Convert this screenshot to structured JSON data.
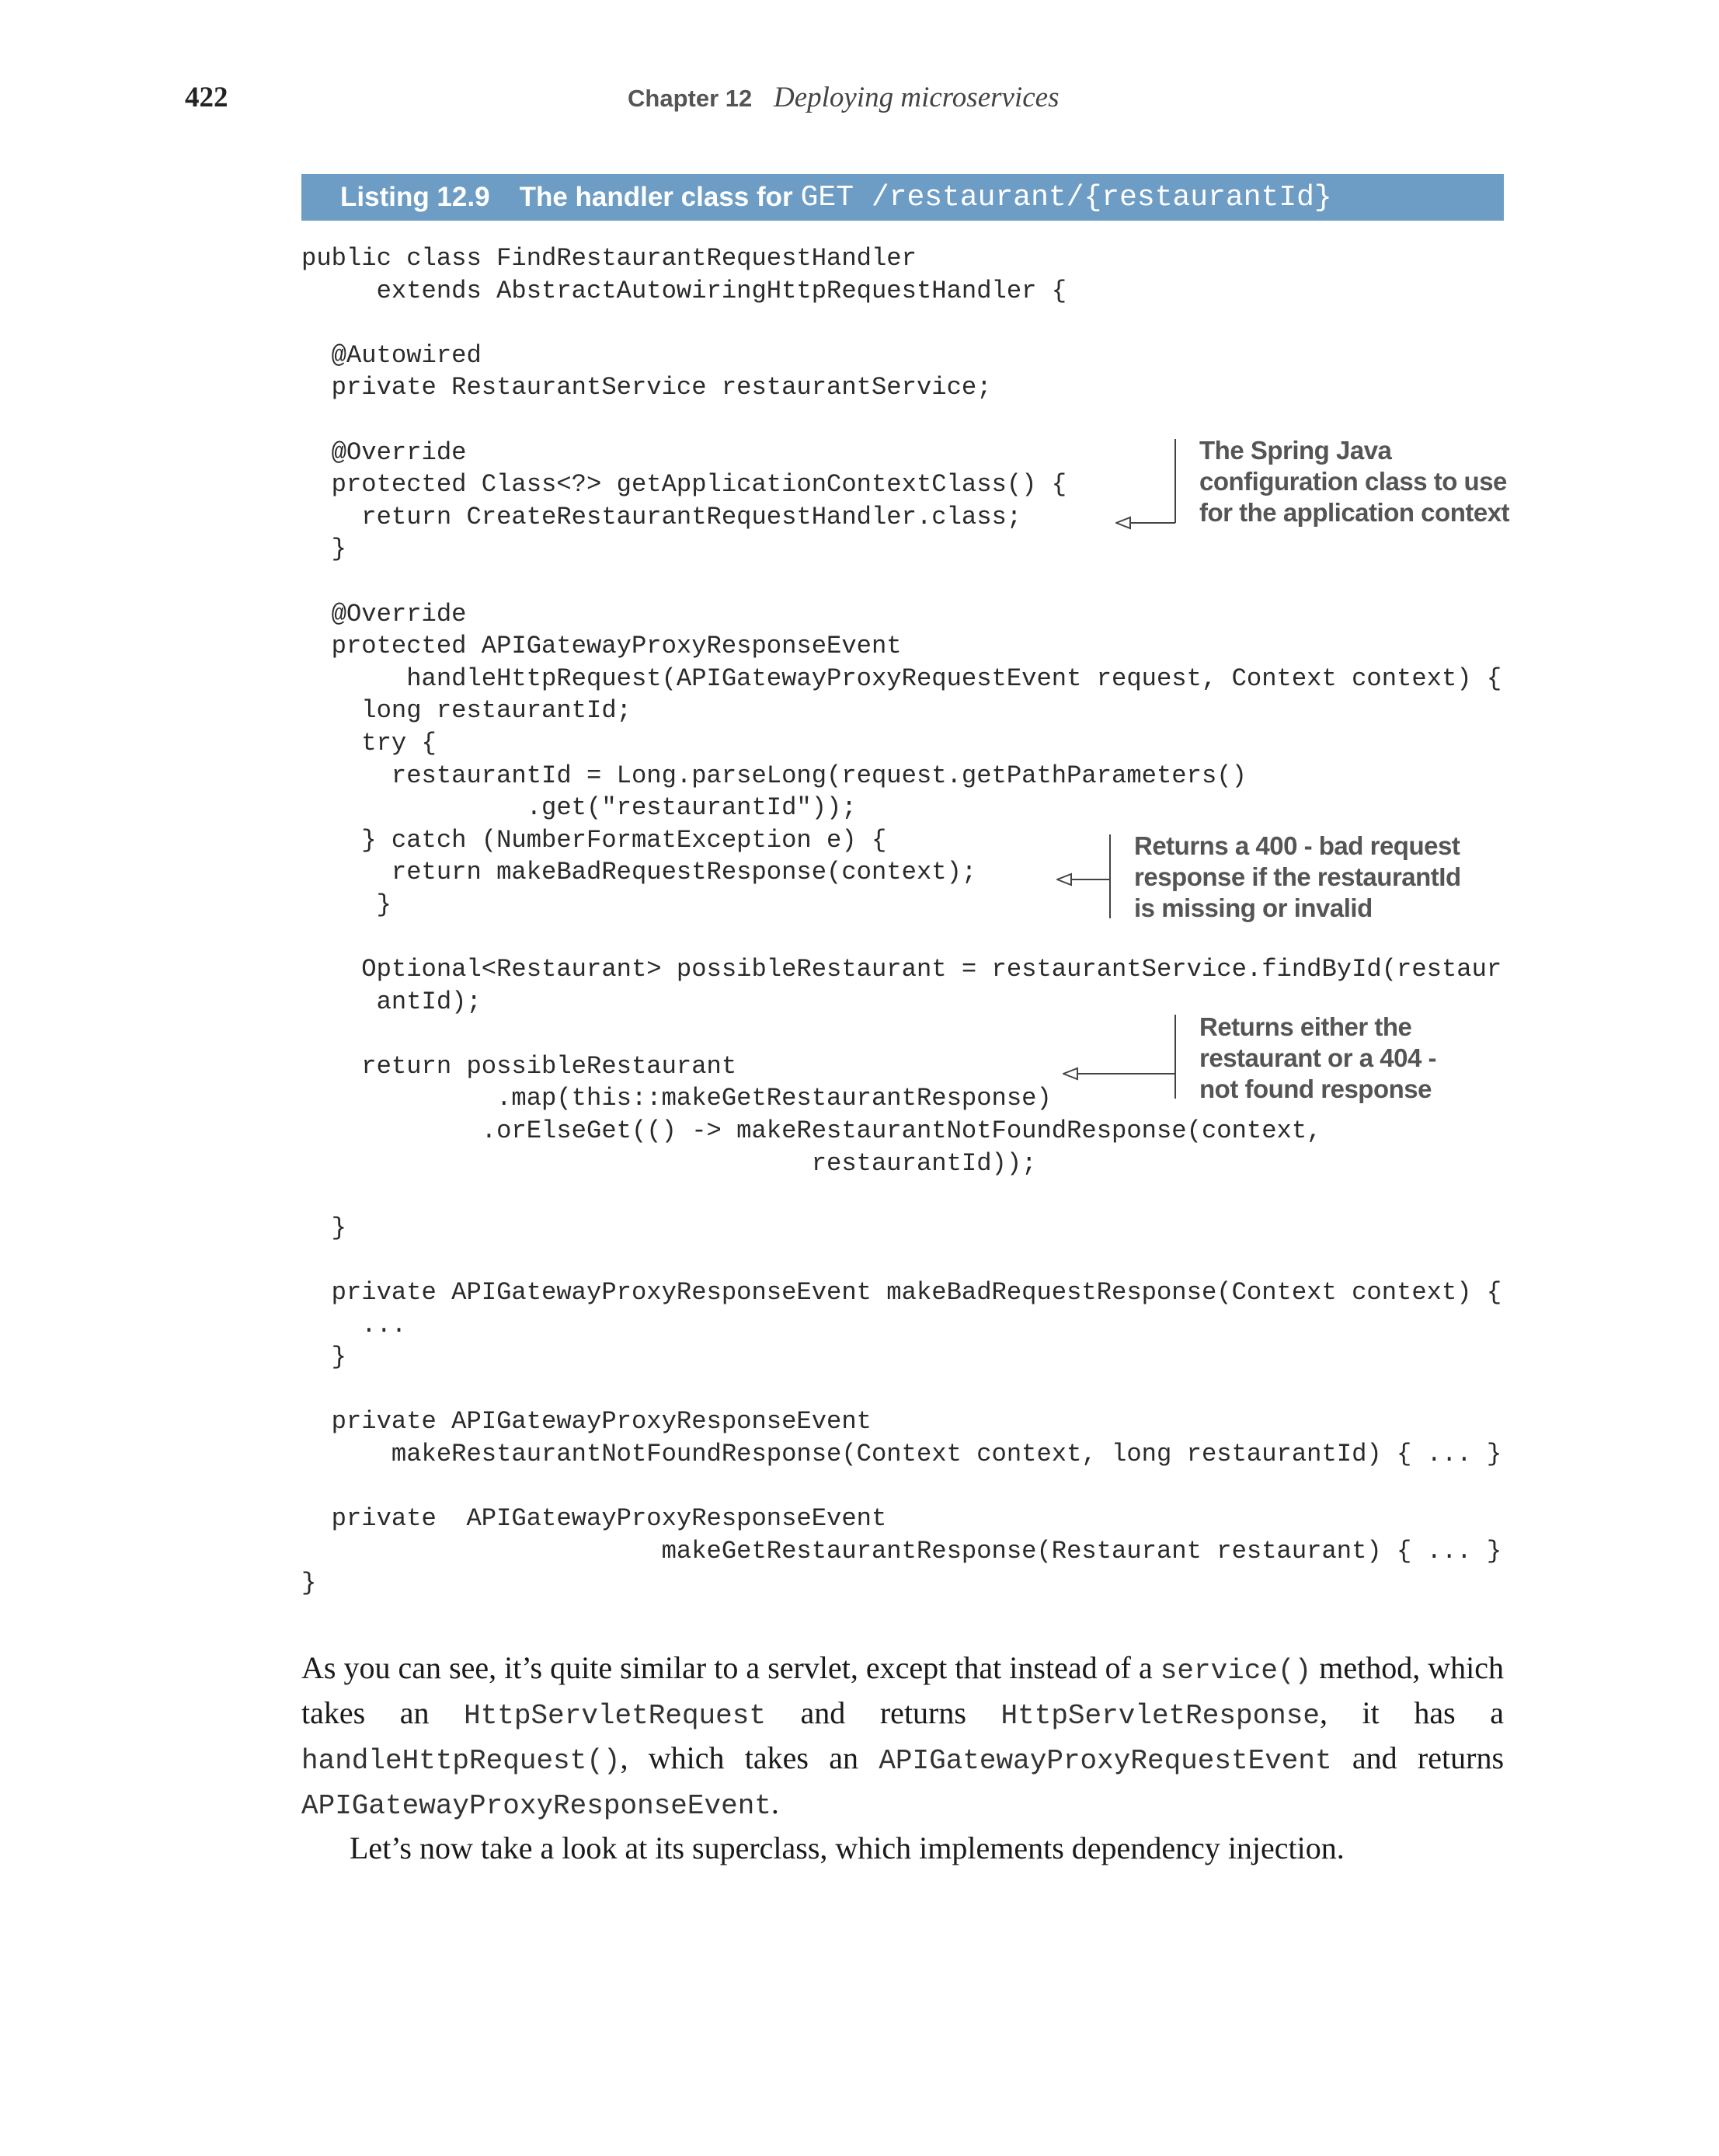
{
  "header": {
    "page_number": "422",
    "chapter_label": "Chapter 12",
    "chapter_title": "Deploying microservices"
  },
  "listing": {
    "label": "Listing 12.9",
    "caption": "The handler class for",
    "caption_code": "GET /restaurant/{restaurantId}"
  },
  "code_lines": [
    "public class FindRestaurantRequestHandler",
    "     extends AbstractAutowiringHttpRequestHandler {",
    "",
    "  @Autowired",
    "  private RestaurantService restaurantService;",
    "",
    "  @Override",
    "  protected Class<?> getApplicationContextClass() {",
    "    return CreateRestaurantRequestHandler.class;",
    "  }",
    "",
    "  @Override",
    "  protected APIGatewayProxyResponseEvent",
    "       handleHttpRequest(APIGatewayProxyRequestEvent request, Context context) {",
    "    long restaurantId;",
    "    try {",
    "      restaurantId = Long.parseLong(request.getPathParameters()",
    "               .get(\"restaurantId\"));",
    "    } catch (NumberFormatException e) {",
    "      return makeBadRequestResponse(context);",
    "     }",
    "",
    "    Optional<Restaurant> possibleRestaurant = restaurantService.findById(restaur",
    "     antId);",
    "",
    "    return possibleRestaurant",
    "             .map(this::makeGetRestaurantResponse)",
    "            .orElseGet(() -> makeRestaurantNotFoundResponse(context,",
    "                                  restaurantId));",
    "",
    "  }",
    "",
    "  private APIGatewayProxyResponseEvent makeBadRequestResponse(Context context) {",
    "    ...",
    "  }",
    "",
    "  private APIGatewayProxyResponseEvent",
    "      makeRestaurantNotFoundResponse(Context context, long restaurantId) { ... }",
    "",
    "  private  APIGatewayProxyResponseEvent",
    "                        makeGetRestaurantResponse(Restaurant restaurant) { ... }",
    "}"
  ],
  "annotations": {
    "context_class": "The Spring Java\nconfiguration class to use\nfor the application context",
    "bad_request": "Returns a 400 - bad request\nresponse if the restaurantId\nis missing or invalid",
    "not_found": "Returns either the\nrestaurant or a 404 -\nnot found response"
  },
  "body": {
    "p1_a": "As you can see, it’s quite similar to a servlet, except that instead of a ",
    "p1_code1": "service()",
    "p1_b": " method, which takes an ",
    "p1_code2": "HttpServletRequest",
    "p1_c": " and returns ",
    "p1_code3": "HttpServletResponse",
    "p1_d": ", it has a ",
    "p1_code4": "handleHttpRequest()",
    "p1_e": ", which takes an ",
    "p1_code5": "APIGatewayProxyRequestEvent",
    "p1_f": " and returns ",
    "p1_code6": "APIGatewayProxyResponseEvent",
    "p1_g": ".",
    "p2": "Let’s now take a look at its superclass, which implements dependency injection."
  }
}
